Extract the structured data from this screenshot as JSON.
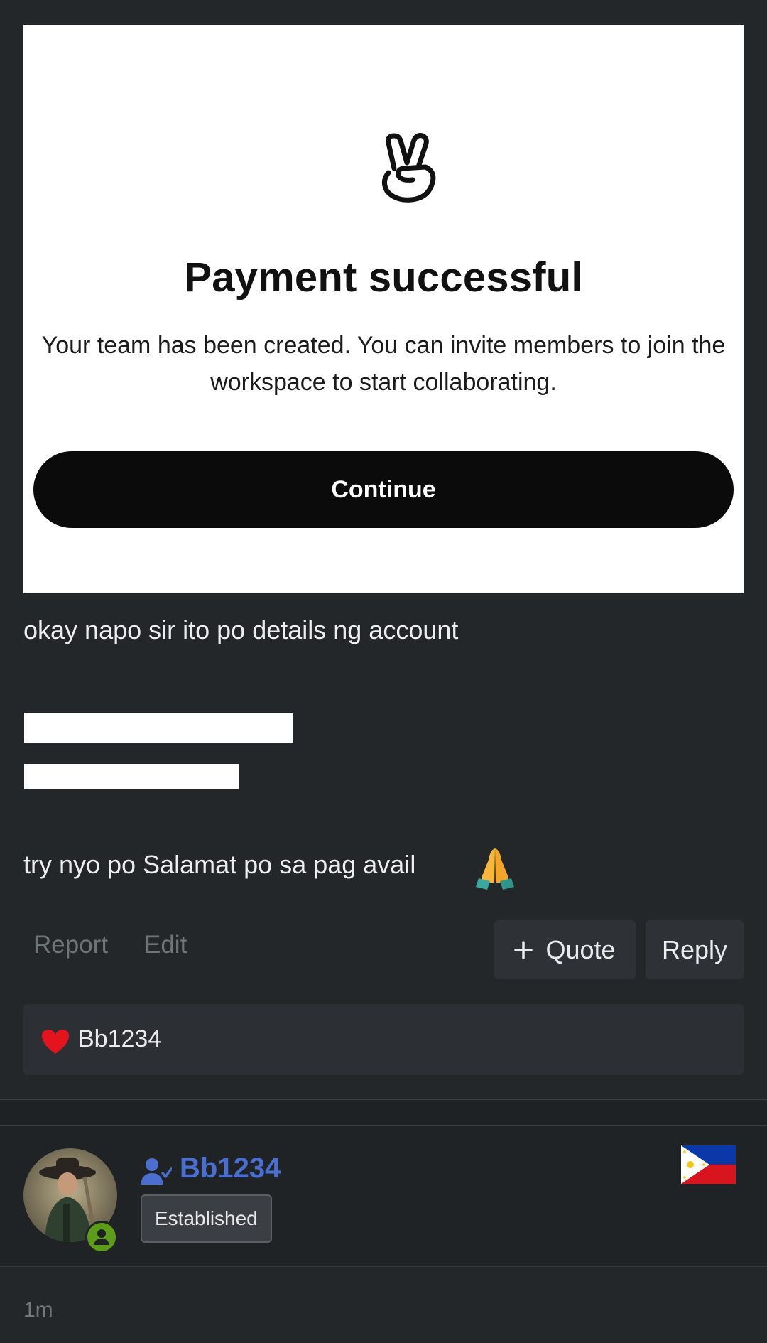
{
  "screenshot": {
    "title": "Payment successful",
    "description": "Your team has been created. You can invite members to join the workspace to start collaborating.",
    "continue_label": "Continue"
  },
  "post": {
    "line1": "okay napo sir ito po details ng account",
    "line_thanks": "try nyo po Salamat po sa pag avail"
  },
  "actions": {
    "report_label": "Report",
    "edit_label": "Edit",
    "quote_label": "Quote",
    "reply_label": "Reply"
  },
  "reactions": {
    "user": "Bb1234"
  },
  "author": {
    "username": "Bb1234",
    "rank": "Established",
    "username_color": "#4a6fd0",
    "online_color": "#5c9c18"
  },
  "timestamp": "1m",
  "icons": [
    "peace-hand-icon",
    "pray-emoji-icon",
    "plus-icon",
    "heart-icon",
    "user-verified-icon",
    "philippines-flag-icon",
    "online-status-icon"
  ]
}
